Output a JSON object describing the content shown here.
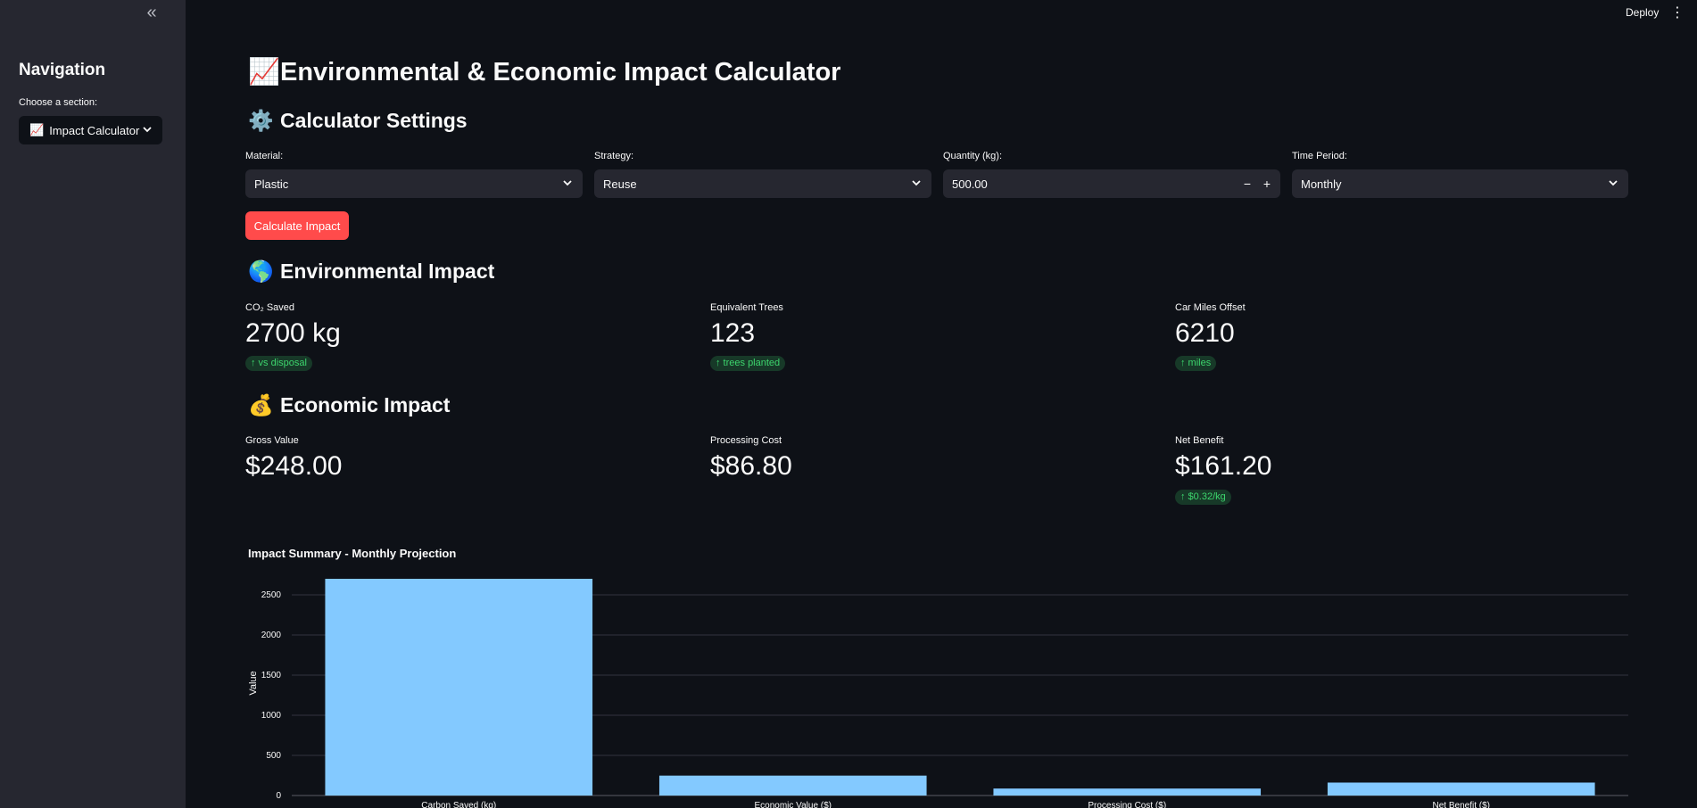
{
  "sidebar": {
    "collapse_icon": "«",
    "title": "Navigation",
    "select_label": "Choose a section:",
    "select_emoji": "📈",
    "select_value": "Impact Calculator"
  },
  "header": {
    "deploy_label": "Deploy",
    "menu_icon": "⋮"
  },
  "main": {
    "title_emoji": "📈",
    "title": "Environmental & Economic Impact Calculator",
    "settings": {
      "emoji": "⚙️",
      "heading": "Calculator Settings",
      "material_label": "Material:",
      "material_value": "Plastic",
      "strategy_label": "Strategy:",
      "strategy_value": "Reuse",
      "quantity_label": "Quantity (kg):",
      "quantity_value": "500.00",
      "minus": "−",
      "plus": "+",
      "period_label": "Time Period:",
      "period_value": "Monthly",
      "calculate_label": "Calculate Impact"
    },
    "environmental": {
      "emoji": "🌎",
      "heading": "Environmental Impact",
      "metrics": [
        {
          "label": "CO₂ Saved",
          "value": "2700 kg",
          "delta": "↑ vs disposal"
        },
        {
          "label": "Equivalent Trees",
          "value": "123",
          "delta": "↑ trees planted"
        },
        {
          "label": "Car Miles Offset",
          "value": "6210",
          "delta": "↑ miles"
        }
      ]
    },
    "economic": {
      "emoji": "💰",
      "heading": "Economic Impact",
      "metrics": [
        {
          "label": "Gross Value",
          "value": "$248.00"
        },
        {
          "label": "Processing Cost",
          "value": "$86.80"
        },
        {
          "label": "Net Benefit",
          "value": "$161.20",
          "delta": "↑ $0.32/kg"
        }
      ]
    }
  },
  "colors": {
    "accent": "#ff4b4b",
    "bar": "#83c9ff",
    "delta_text": "#3dd56d",
    "delta_bg": "#173928"
  },
  "chart_data": {
    "type": "bar",
    "title": "Impact Summary - Monthly Projection",
    "xlabel": "",
    "ylabel": "Value",
    "categories": [
      "Carbon Saved (kg)",
      "Economic Value ($)",
      "Processing Cost ($)",
      "Net Benefit ($)"
    ],
    "values": [
      2700,
      248,
      86.8,
      161.2
    ],
    "yticks": [
      "0",
      "500",
      "1000",
      "1500",
      "2000",
      "2500"
    ],
    "ylim": [
      0,
      2800
    ],
    "grid": true
  }
}
